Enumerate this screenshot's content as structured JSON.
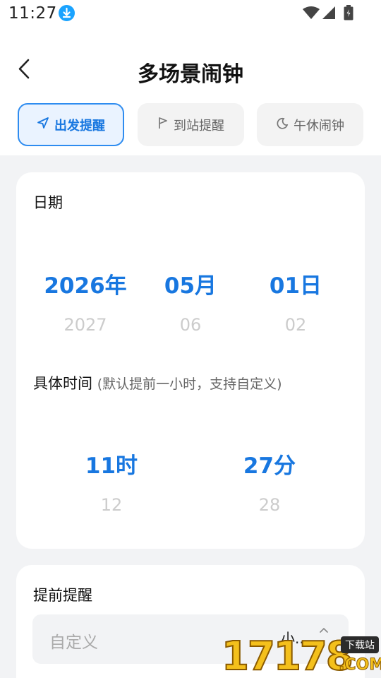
{
  "status_bar": {
    "time": "11:27",
    "icons": [
      "download-icon",
      "wifi-icon",
      "cellular-icon",
      "battery-icon"
    ]
  },
  "nav": {
    "title": "多场景闹钟",
    "back_icon": "back-arrow-icon"
  },
  "tabs": [
    {
      "label": "出发提醒",
      "icon": "send-arrow-icon",
      "active": true
    },
    {
      "label": "到站提醒",
      "icon": "flag-icon",
      "active": false
    },
    {
      "label": "午休闹钟",
      "icon": "moon-icon",
      "active": false
    }
  ],
  "date_section": {
    "title": "日期",
    "year": {
      "selected": "2026年",
      "next": "2027"
    },
    "month": {
      "selected": "05月",
      "next": "06"
    },
    "day": {
      "selected": "01日",
      "next": "02"
    }
  },
  "time_section": {
    "title": "具体时间",
    "hint": "(默认提前一小时，支持自定义)",
    "hour": {
      "selected": "11时",
      "next": "12"
    },
    "minute": {
      "selected": "27分",
      "next": "28"
    }
  },
  "remind_section": {
    "title": "提前提醒",
    "placeholder": "自定义",
    "unit": "小..."
  },
  "watermark": {
    "digits": "17178",
    "badge": "下载站",
    "suffix": ".COM"
  },
  "colors": {
    "accent": "#1877e0",
    "tab_active_bg": "#eaf3ff",
    "tab_active_border": "#2e8cf0",
    "page_bg": "#f2f3f5",
    "picker_dim": "#cccccc"
  }
}
